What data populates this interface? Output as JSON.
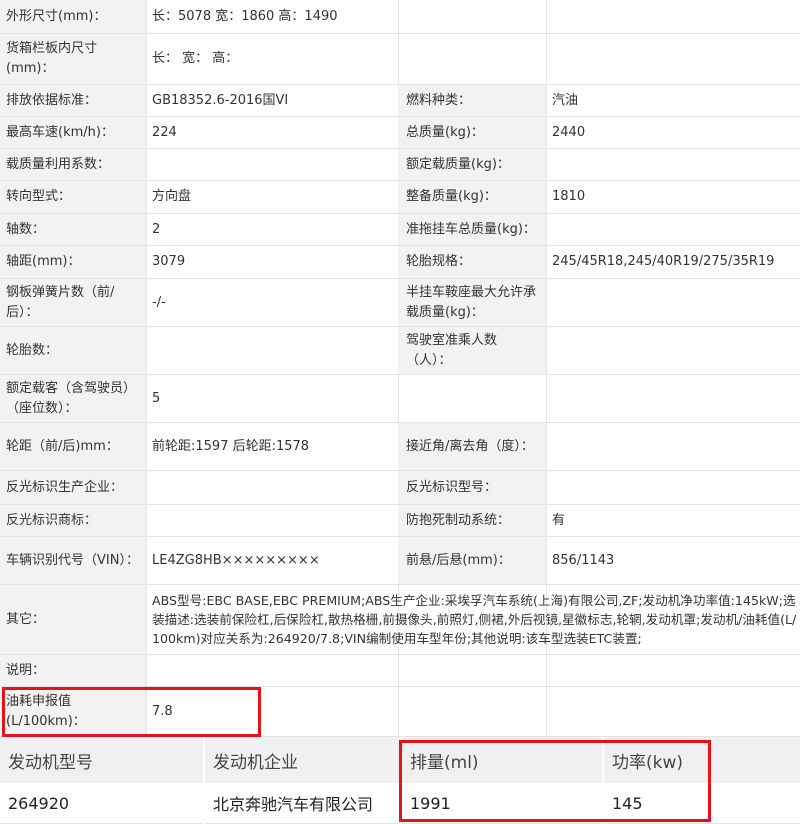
{
  "rows": [
    {
      "label": "外形尺寸(mm)：",
      "value": "长：5078 宽：1860 高：1490"
    },
    {
      "label": "货箱栏板内尺寸(mm)：",
      "value": "长： 宽： 高："
    },
    {
      "label": "排放依据标准：",
      "value": "GB18352.6-2016国VI",
      "label2": "燃料种类：",
      "value2": "汽油"
    },
    {
      "label": "最高车速(km/h)：",
      "value": "224",
      "label2": "总质量(kg)：",
      "value2": "2440"
    },
    {
      "label": "载质量利用系数：",
      "value": "",
      "label2": "额定载质量(kg)：",
      "value2": ""
    },
    {
      "label": "转向型式：",
      "value": "方向盘",
      "label2": "整备质量(kg)：",
      "value2": "1810"
    },
    {
      "label": "轴数：",
      "value": "2",
      "label2": "准拖挂车总质量(kg)：",
      "value2": ""
    },
    {
      "label": "轴距(mm)：",
      "value": "3079",
      "label2": "轮胎规格：",
      "value2": "245/45R18,245/40R19/275/35R19"
    },
    {
      "label": "钢板弹簧片数（前/后）：",
      "value": "-/-",
      "label2": "半挂车鞍座最大允许承载质量(kg)：",
      "value2": ""
    },
    {
      "label": "轮胎数：",
      "value": "",
      "label2": "驾驶室准乘人数（人）：",
      "value2": ""
    },
    {
      "label": "额定载客（含驾驶员）（座位数）：",
      "value": "5"
    },
    {
      "label": "轮距（前/后)mm：",
      "value": "前轮距:1597 后轮距:1578",
      "label2": "接近角/离去角（度）：",
      "value2": ""
    },
    {
      "label": "反光标识生产企业：",
      "value": "",
      "label2": "反光标识型号：",
      "value2": ""
    },
    {
      "label": "反光标识商标：",
      "value": "",
      "label2": "防抱死制动系统：",
      "value2": "有"
    },
    {
      "label": "车辆识别代号（VIN）：",
      "value": "LE4ZG8HB×××××××××",
      "label2": "前悬/后悬(mm)：",
      "value2": "856/1143"
    },
    {
      "label": "其它：",
      "value": "ABS型号:EBC BASE,EBC PREMIUM;ABS生产企业:采埃孚汽车系统(上海)有限公司,ZF;发动机净功率值:145kW;选装描述:选装前保险杠,后保险杠,散热格栅,前摄像头,前照灯,侧裙,外后视镜,星徽标志,轮辋,发动机罩;发动机/油耗值(L/100km)对应关系为:264920/7.8;VIN编制使用车型年份;其他说明:该车型选装ETC装置;"
    },
    {
      "label": "说明：",
      "value": ""
    },
    {
      "label": "油耗申报值(L/100km)：",
      "value": "7.8"
    }
  ],
  "engine": {
    "headers": [
      "发动机型号",
      "发动机企业",
      "排量(ml)",
      "功率(kw)"
    ],
    "values": [
      "264920",
      "北京奔驰汽车有限公司",
      "1991",
      "145"
    ]
  },
  "colors": {
    "highlight": "#e0141a",
    "label_bg": "#f2f2f2",
    "header_bg": "#f0f0f0"
  }
}
